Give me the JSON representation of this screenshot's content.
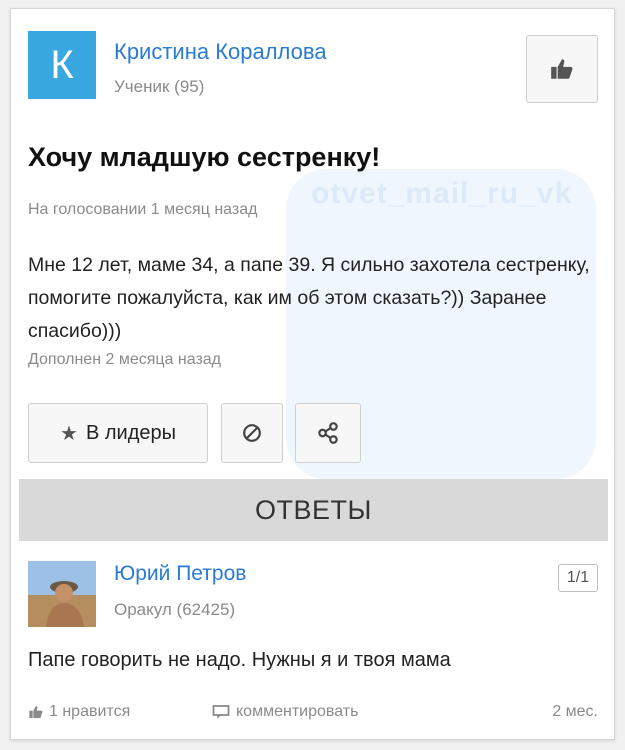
{
  "question": {
    "author": {
      "avatar_letter": "К",
      "name": "Кристина Кораллова",
      "rank": "Ученик (95)"
    },
    "title": "Хочу младшую сестренку!",
    "meta": "На голосовании 1 месяц назад",
    "body": "Мне 12 лет, маме 34, а папе 39. Я сильно захотела сестренку, помогите пожалуйста, как им об этом сказать?)) Заранее спасибо)))",
    "added": "Дополнен 2 месяца назад",
    "leaders_label": "В лидеры"
  },
  "answers_header": "ОТВЕТЫ",
  "answer": {
    "name": "Юрий Петров",
    "rank": "Оракул (62425)",
    "counter": "1/1",
    "text": "Папе говорить не надо. Нужны я и твоя мама",
    "like_label": "1 нравится",
    "comment_label": "комментировать",
    "time": "2 мес."
  },
  "watermark": "otvet_mail_ru_vk",
  "colors": {
    "link": "#2a7bd6",
    "avatar_bg": "#3aa8e0",
    "answers_bar": "#d9d9d9"
  },
  "icons": [
    "thumbs-up-icon",
    "star-icon",
    "block-icon",
    "share-icon",
    "comment-icon"
  ]
}
